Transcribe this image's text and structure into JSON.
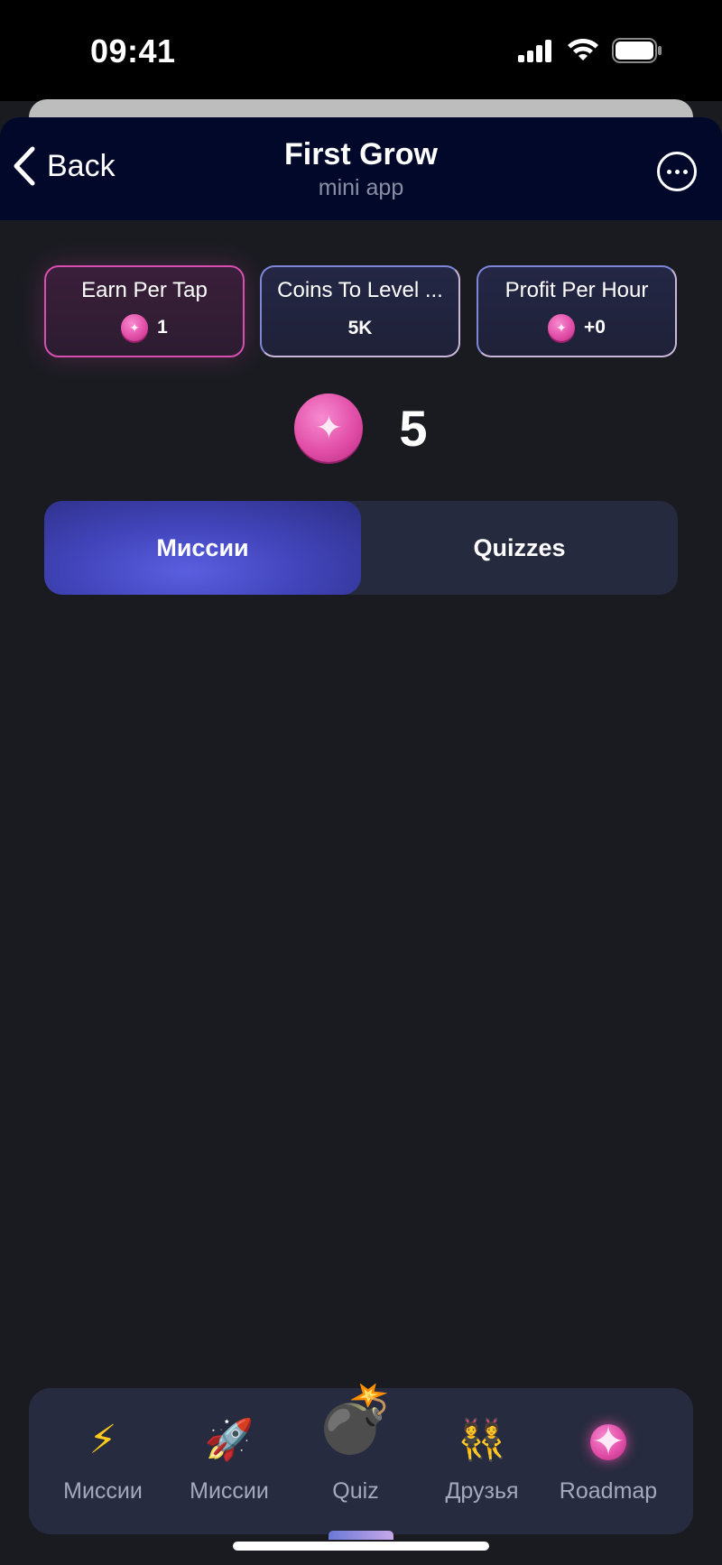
{
  "status_bar": {
    "time": "09:41",
    "icons": [
      "signal-icon",
      "wifi-icon",
      "battery-icon"
    ]
  },
  "header": {
    "back_label": "Back",
    "title": "First Grow",
    "subtitle": "mini app",
    "more_icon": "more-icon"
  },
  "stats": [
    {
      "label": "Earn Per Tap",
      "value": "1",
      "has_coin": true
    },
    {
      "label": "Coins To Level ...",
      "value": "5K",
      "has_coin": false
    },
    {
      "label": "Profit Per Hour",
      "value": "+0",
      "has_coin": true
    }
  ],
  "balance": {
    "value": "5"
  },
  "tabs": [
    {
      "label": "Миссии",
      "active": true
    },
    {
      "label": "Quizzes",
      "active": false
    }
  ],
  "nav": [
    {
      "label": "Миссии",
      "icon": "⚡",
      "icon_name": "lightning-icon"
    },
    {
      "label": "Миссии",
      "icon": "🚀",
      "icon_name": "rocket-icon"
    },
    {
      "label": "Quiz",
      "icon": "💣",
      "icon_name": "bomb-icon",
      "active": true
    },
    {
      "label": "Друзья",
      "icon": "👯",
      "icon_name": "friends-icon"
    },
    {
      "label": "Roadmap",
      "icon": "✦",
      "icon_name": "roadmap-coin-icon"
    }
  ],
  "colors": {
    "background": "#1a1b21",
    "header": "#02082a",
    "accent_pink": "#d94fb0",
    "accent_blue": "#4a4fd0",
    "panel": "#262a3e"
  }
}
